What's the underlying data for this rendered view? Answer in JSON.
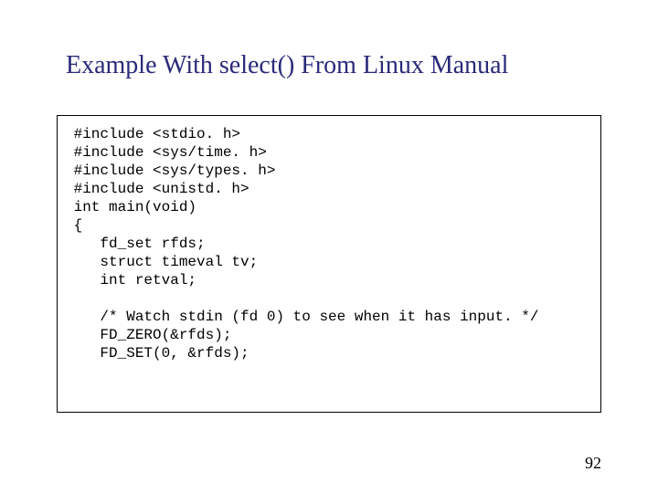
{
  "title": "Example With select() From Linux Manual",
  "code": " #include <stdio. h>\n #include <sys/time. h>\n #include <sys/types. h>\n #include <unistd. h>\n int main(void)\n {\n    fd_set rfds;\n    struct timeval tv;\n    int retval;\n\n    /* Watch stdin (fd 0) to see when it has input. */\n    FD_ZERO(&rfds);\n    FD_SET(0, &rfds);",
  "page_number": "92"
}
